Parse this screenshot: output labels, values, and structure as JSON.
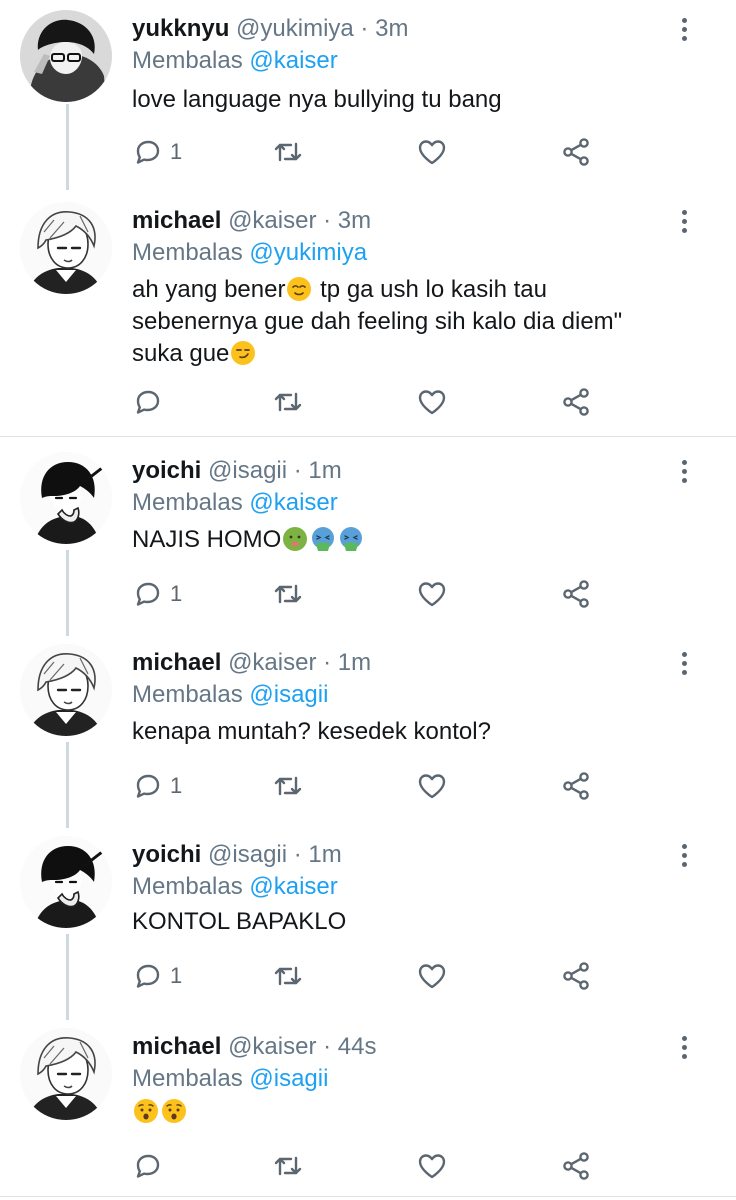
{
  "reply_prefix": "Membalas",
  "colors": {
    "link": "#1da1f2",
    "text": "#14171a",
    "muted": "#657786",
    "thread_line": "#cfd9de"
  },
  "icons": {
    "reply": "comment-icon",
    "retweet": "retweet-icon",
    "like": "heart-icon",
    "share": "share-icon",
    "menu": "more-vertical-icon"
  },
  "tweets": [
    {
      "name": "yukknyu",
      "handle": "@yukimiya",
      "sep": " · ",
      "time": "3m",
      "reply_to": "@kaiser",
      "text": "love language nya bullying tu bang",
      "reply_count": "1"
    },
    {
      "name": "michael",
      "handle": "@kaiser",
      "sep": " · ",
      "time": "3m",
      "reply_to": "@yukimiya",
      "text_parts": [
        "ah yang bener",
        " tp ga ush lo kasih tau\nsebenernya gue dah feeling sih kalo dia diem\"\nsuka gue",
        ""
      ],
      "emojis": [
        "relieved-face-emoji",
        "smirking-face-emoji"
      ],
      "reply_count": ""
    },
    {
      "name": "yoichi",
      "handle": "@isagii",
      "sep": " · ",
      "time": "1m",
      "reply_to": "@kaiser",
      "text": "NAJIS HOMO",
      "emojis": [
        "nauseated-face-emoji",
        "vomiting-face-emoji",
        "vomiting-face-emoji"
      ],
      "reply_count": "1"
    },
    {
      "name": "michael",
      "handle": "@kaiser",
      "sep": " · ",
      "time": "1m",
      "reply_to": "@isagii",
      "text": "kenapa muntah? kesedek kontol?",
      "reply_count": "1"
    },
    {
      "name": "yoichi",
      "handle": "@isagii",
      "sep": " · ",
      "time": "1m",
      "reply_to": "@kaiser",
      "text": "KONTOL BAPAKLO",
      "reply_count": "1"
    },
    {
      "name": "michael",
      "handle": "@kaiser",
      "sep": " · ",
      "time": "44s",
      "reply_to": "@isagii",
      "text": "",
      "emojis": [
        "hushed-face-emoji",
        "hushed-face-emoji"
      ],
      "reply_count": ""
    }
  ]
}
